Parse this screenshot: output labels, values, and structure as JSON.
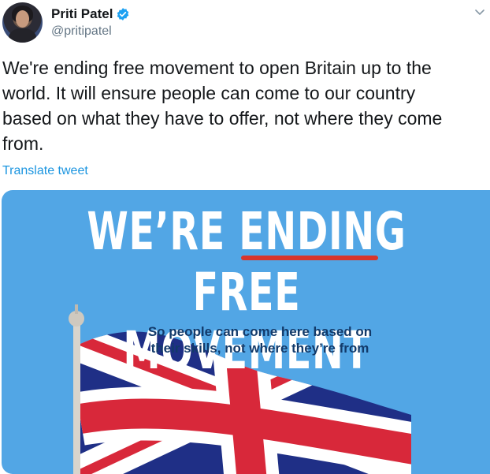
{
  "author": {
    "name": "Priti Patel",
    "handle": "@pritipatel",
    "verified": true
  },
  "tweet": {
    "text": "We're ending free movement to open Britain up to the\nworld. It will ensure people can come to our country\nbased on what they have to offer, not where they come\nfrom.",
    "translate_label": "Translate tweet"
  },
  "image": {
    "headline_line1": "WE’RE ENDING",
    "headline_line2": "FREE MOVEMENT",
    "subtitle_line1": "So people can come here based on",
    "subtitle_line2": "their skills, not where they’re from"
  },
  "colors": {
    "link": "#1b95e0",
    "card_background": "#52a6e5",
    "underline": "#d8352b",
    "flag_blue": "#1f2f86",
    "flag_red": "#d8283a"
  },
  "icons": {
    "verified": "verified-badge-icon",
    "menu": "chevron-down-icon"
  }
}
